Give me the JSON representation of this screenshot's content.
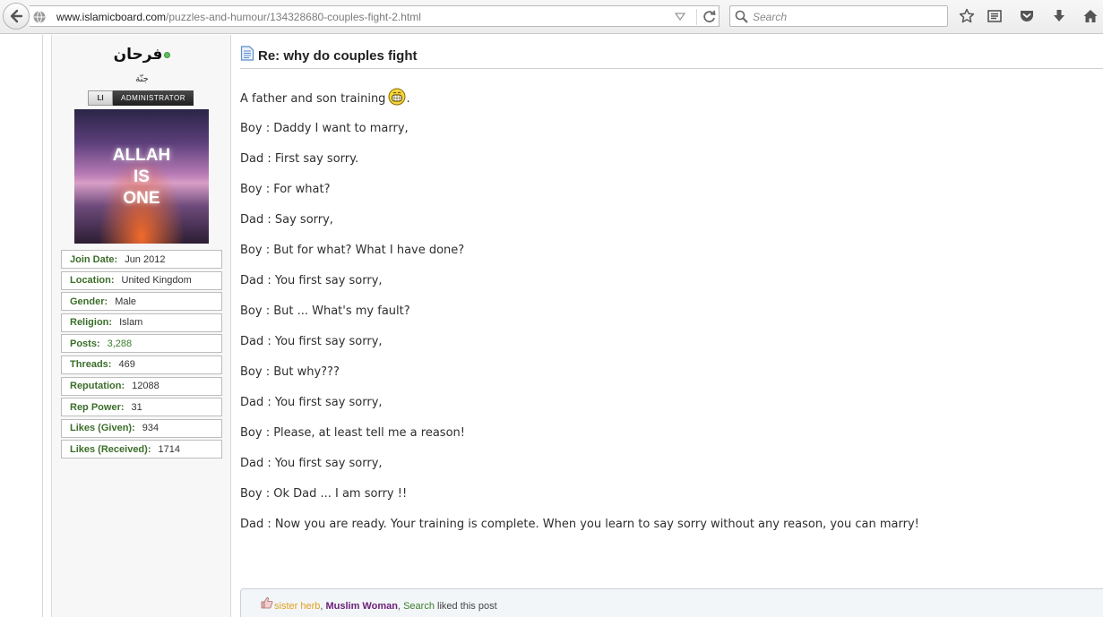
{
  "browser": {
    "url_host": "www.islamicboard.com",
    "url_path": "/puzzles-and-humour/134328680-couples-fight-2.html",
    "search_placeholder": "Search"
  },
  "user": {
    "name": "فرحان",
    "title": "جنّة",
    "rank_prefix": "LI",
    "rank": "ADMINISTRATOR",
    "avatar_text": [
      "ALLAH",
      "IS",
      "ONE"
    ],
    "stats": [
      {
        "label": "Join Date:",
        "value": "Jun 2012"
      },
      {
        "label": "Location:",
        "value": "United Kingdom"
      },
      {
        "label": "Gender:",
        "value": "Male"
      },
      {
        "label": "Religion:",
        "value": "Islam"
      },
      {
        "label": "Posts:",
        "value": "3,288"
      },
      {
        "label": "Threads:",
        "value": "469"
      },
      {
        "label": "Reputation:",
        "value": "12088"
      },
      {
        "label": "Rep Power:",
        "value": "31"
      },
      {
        "label": "Likes (Given):",
        "value": "934"
      },
      {
        "label": "Likes (Received):",
        "value": "1714"
      }
    ]
  },
  "post": {
    "title": "Re: why do couples fight",
    "intro": "A father and son training",
    "intro_end": ".",
    "lines": [
      "Boy : Daddy I want to marry,",
      "Dad : First say sorry.",
      "Boy : For what?",
      "Dad : Say sorry,",
      "Boy : But for what? What I have done?",
      "Dad : You first say sorry,",
      "Boy : But ... What's my fault?",
      "Dad : You first say sorry,",
      "Boy : But why???",
      "Dad : You first say sorry,",
      "Boy : Please, at least tell me a reason!",
      "Dad : You first say sorry,",
      "Boy : Ok Dad ... I am sorry !!",
      "Dad : Now you are ready. Your training is complete. When you learn to say sorry without any reason, you can marry!"
    ]
  },
  "likes": {
    "users": [
      "sister herb",
      "Muslim Woman",
      "Search"
    ],
    "separator": ", ",
    "suffix": " liked this post"
  }
}
